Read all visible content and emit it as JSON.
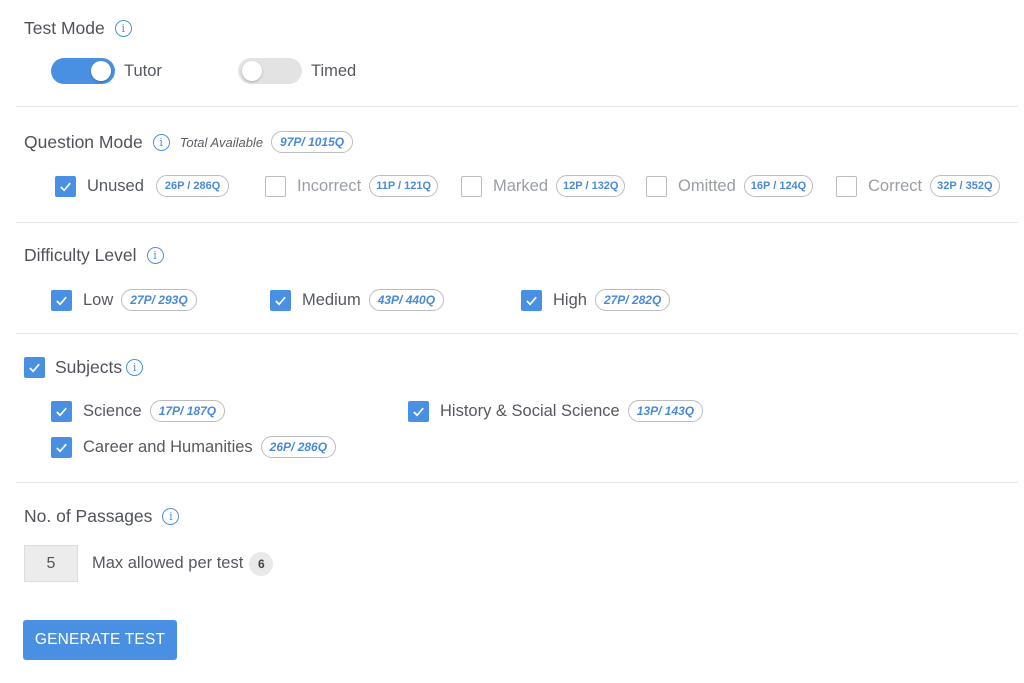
{
  "test_mode": {
    "title": "Test Mode",
    "info_icon": "info-icon",
    "toggles": [
      {
        "label": "Tutor",
        "on": true
      },
      {
        "label": "Timed",
        "on": false
      }
    ]
  },
  "question_mode": {
    "title": "Question Mode",
    "total_label": "Total Available",
    "total_count": "97P/ 1015Q",
    "options": [
      {
        "label": "Unused",
        "count": "26P / 286Q",
        "checked": true
      },
      {
        "label": "Incorrect",
        "count": "11P / 121Q",
        "checked": false
      },
      {
        "label": "Marked",
        "count": "12P / 132Q",
        "checked": false
      },
      {
        "label": "Omitted",
        "count": "16P / 124Q",
        "checked": false
      },
      {
        "label": "Correct",
        "count": "32P / 352Q",
        "checked": false
      }
    ]
  },
  "difficulty": {
    "title": "Difficulty Level",
    "options": [
      {
        "label": "Low",
        "count": "27P/ 293Q",
        "checked": true
      },
      {
        "label": "Medium",
        "count": "43P/ 440Q",
        "checked": true
      },
      {
        "label": "High",
        "count": "27P/ 282Q",
        "checked": true
      }
    ]
  },
  "subjects": {
    "title": "Subjects",
    "checked": true,
    "options": [
      {
        "label": "Science",
        "count": "17P/ 187Q",
        "checked": true
      },
      {
        "label": "History & Social Science",
        "count": "13P/ 143Q",
        "checked": true
      },
      {
        "label": "Career and Humanities",
        "count": "26P/ 286Q",
        "checked": true
      }
    ]
  },
  "passages": {
    "title": "No. of Passages",
    "value": "5",
    "max_label": "Max allowed per test",
    "max_value": "6"
  },
  "generate_button": "GENERATE TEST",
  "colors": {
    "accent": "#4a90e2",
    "divider": "#e6e7e9"
  }
}
